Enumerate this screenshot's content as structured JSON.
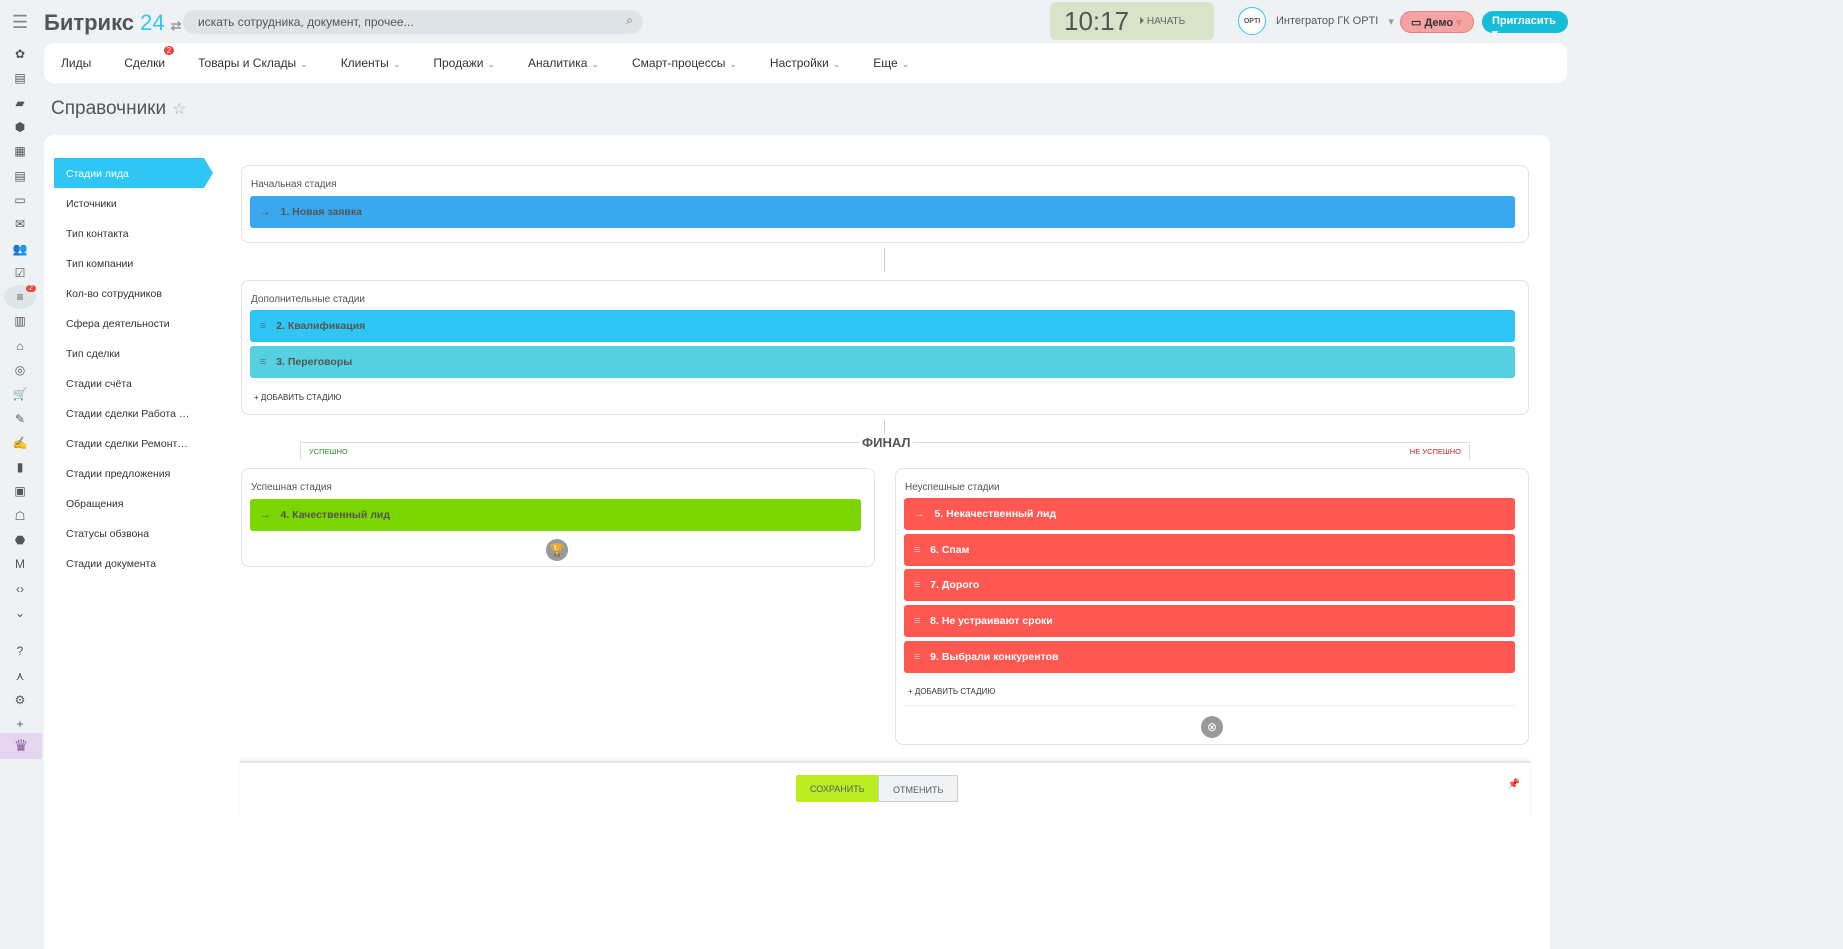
{
  "header": {
    "logo_text": "Битрикс",
    "logo_num": "24",
    "search_placeholder": "искать сотрудника, документ, прочее...",
    "clock": "10:17",
    "start_label": "НАЧАТЬ",
    "user_name": "Интегратор ГК OPTI",
    "avatar_text": "OPTI",
    "demo_label": "Демо",
    "invite_label": "Пригласить"
  },
  "leftbar": {
    "badge": "2",
    "icons": [
      "feed-icon",
      "calendar-icon",
      "chat-icon",
      "hexagon-icon",
      "calendar-grid-icon",
      "document-icon",
      "drive-icon",
      "mail-icon",
      "group-icon",
      "tasks-icon",
      "crm-filter-icon",
      "shop-icon",
      "bank-icon",
      "target-icon",
      "cart-icon",
      "edit-icon",
      "sign-icon",
      "chart-icon",
      "contact-card-icon",
      "robot-icon",
      "box-icon",
      "market-icon",
      "code-icon",
      "more-icon",
      "help-icon",
      "sitemap-icon",
      "settings-icon",
      "plus-icon"
    ]
  },
  "menu": [
    {
      "label": "Лиды",
      "chev": false
    },
    {
      "label": "Сделки",
      "chev": false,
      "badge": "2"
    },
    {
      "label": "Товары и Склады",
      "chev": true
    },
    {
      "label": "Клиенты",
      "chev": true
    },
    {
      "label": "Продажи",
      "chev": true
    },
    {
      "label": "Аналитика",
      "chev": true
    },
    {
      "label": "Смарт-процессы",
      "chev": true
    },
    {
      "label": "Настройки",
      "chev": true
    },
    {
      "label": "Еще",
      "chev": true
    }
  ],
  "page_title": "Справочники",
  "nav": [
    "Стадии лида",
    "Источники",
    "Тип контакта",
    "Тип компании",
    "Кол-во сотрудников",
    "Сфера деятельности",
    "Тип сделки",
    "Стадии счёта",
    "Стадии сделки Работа с заявками",
    "Стадии сделки Ремонтные работы",
    "Стадии предложения",
    "Обращения",
    "Статусы обзвона",
    "Стадии документа"
  ],
  "initial": {
    "label": "Начальная стадия",
    "stage": "1. Новая заявка",
    "color": "#39a8ef"
  },
  "extra": {
    "label": "Дополнительные стадии",
    "stages": [
      {
        "name": "2. Квалификация",
        "color": "#2fc6f6"
      },
      {
        "name": "3. Переговоры",
        "color": "#55d0e0"
      }
    ],
    "add_label": "+ ДОБАВИТЬ СТАДИЮ"
  },
  "final": {
    "title": "ФИНАЛ",
    "success_tab": "УСПЕШНО",
    "fail_tab": "НЕ УСПЕШНО"
  },
  "success": {
    "label": "Успешная стадия",
    "stage": "4. Качественный лид",
    "color": "#7bd500"
  },
  "fail": {
    "label": "Неуспешные стадии",
    "color": "#ff5752",
    "stages": [
      "5. Некачественный лид",
      "6. Спам",
      "7. Дорого",
      "8. Не устраивают сроки",
      "9. Выбрали конкурентов"
    ],
    "add_label": "+ ДОБАВИТЬ СТАДИЮ"
  },
  "footer": {
    "save": "СОХРАНИТЬ",
    "cancel": "ОТМЕНИТЬ"
  }
}
